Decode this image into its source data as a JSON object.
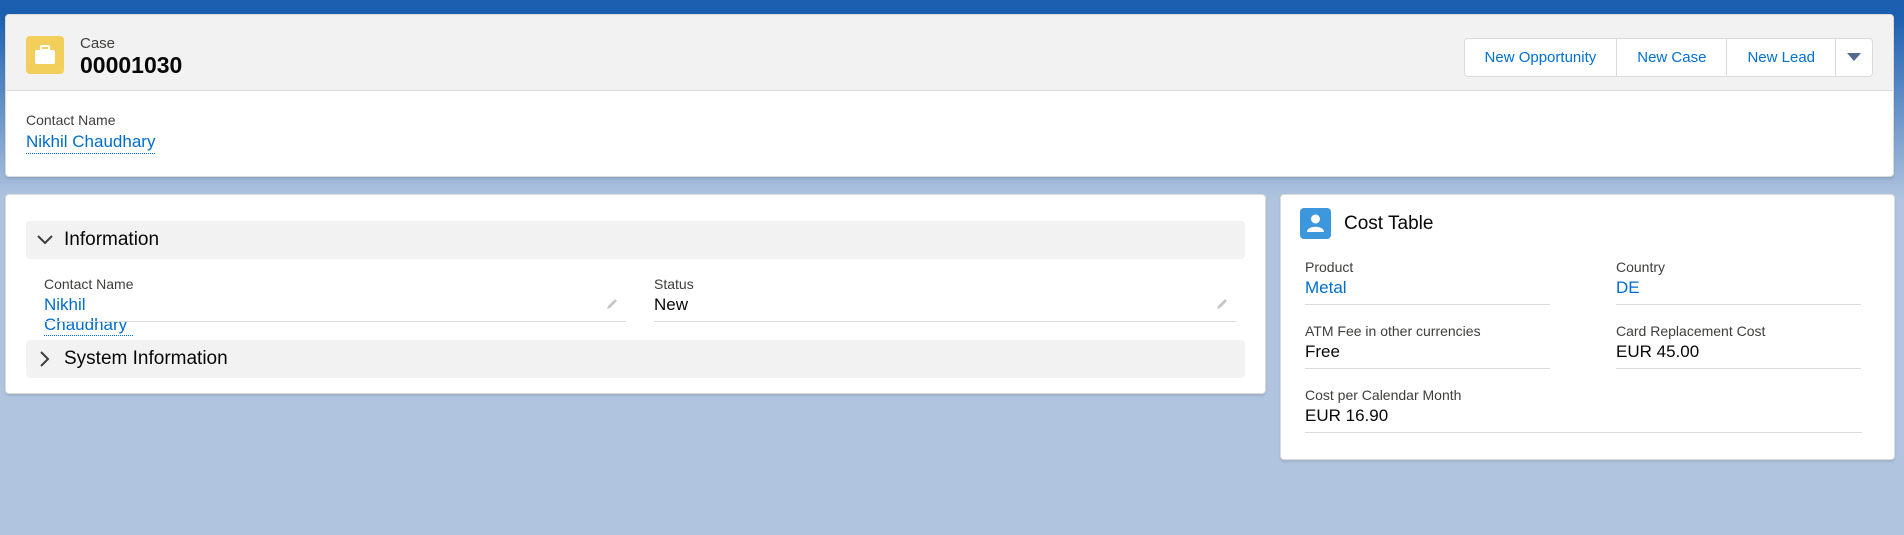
{
  "header": {
    "object_label": "Case",
    "record_number": "00001030",
    "actions": [
      "New Opportunity",
      "New Case",
      "New Lead"
    ],
    "fields": {
      "contact_name_label": "Contact Name",
      "contact_name_value": "Nikhil Chaudhary"
    }
  },
  "details": {
    "sections": [
      {
        "title": "Information",
        "expanded": true
      },
      {
        "title": "System Information",
        "expanded": false
      }
    ],
    "fields": {
      "contact_name_label": "Contact Name",
      "contact_name_value": "Nikhil Chaudhary",
      "status_label": "Status",
      "status_value": "New"
    }
  },
  "cost_table": {
    "title": "Cost Table",
    "fields": [
      {
        "label": "Product",
        "value": "Metal",
        "link": true
      },
      {
        "label": "Country",
        "value": "DE",
        "link": true
      },
      {
        "label": "ATM Fee in other currencies",
        "value": "Free",
        "link": false
      },
      {
        "label": "Card Replacement Cost",
        "value": "EUR 45.00",
        "link": false
      },
      {
        "label": "Cost per Calendar Month",
        "value": "EUR 16.90",
        "link": false
      }
    ]
  },
  "colors": {
    "brand_blue": "#1b5fb0",
    "link_blue": "#006dcc",
    "case_icon_bg": "#f2cf5b",
    "cost_icon_bg": "#3c97dd"
  }
}
